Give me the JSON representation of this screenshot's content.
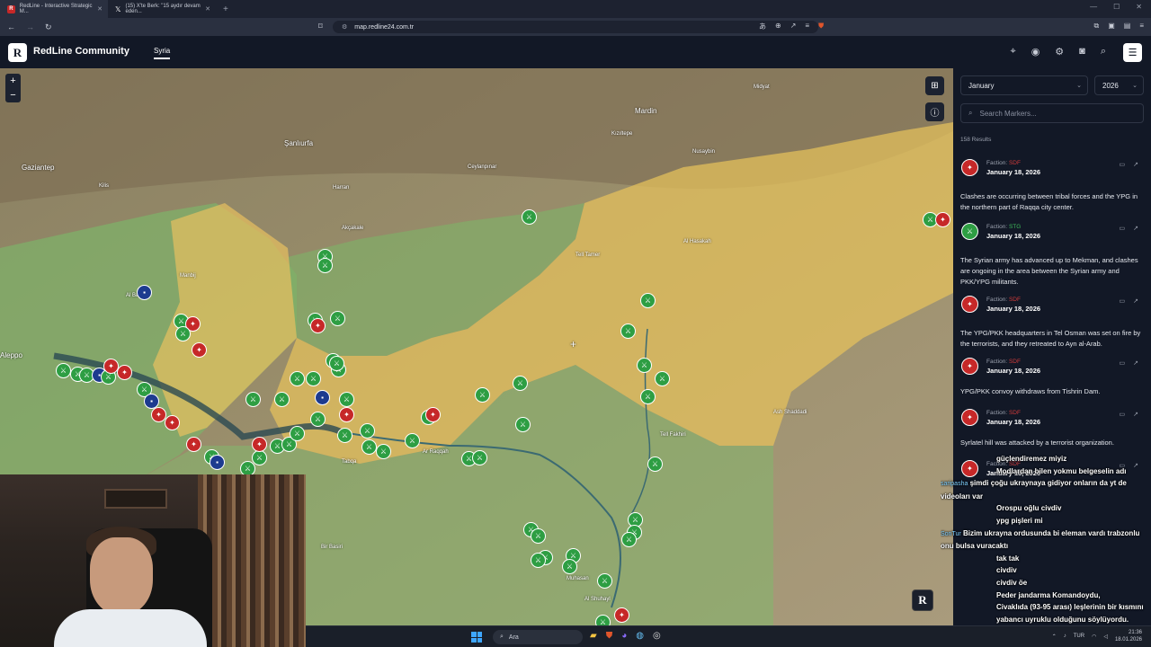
{
  "browser": {
    "tabs": [
      {
        "label": "RedLine - Interactive Strategic M..."
      },
      {
        "label": "(15) X'te Berk: \"15 aydır devam eden..."
      }
    ],
    "url": "map.redline24.com.tr"
  },
  "header": {
    "brand": "RedLine Community",
    "logo_letter": "R",
    "region_tab": "Syria"
  },
  "map": {
    "zoom_in": "+",
    "zoom_out": "−",
    "labels": [
      {
        "text": "Gaziantep",
        "big": true
      },
      {
        "text": "Şanlıurfa",
        "big": true
      },
      {
        "text": "Mardin",
        "big": true
      },
      {
        "text": "Aleppo",
        "big": true
      },
      {
        "text": "Kilis"
      },
      {
        "text": "Harran"
      },
      {
        "text": "Akçakale"
      },
      {
        "text": "Ceylanpınar"
      },
      {
        "text": "Kızıltepe"
      },
      {
        "text": "Nusaybin"
      },
      {
        "text": "Midyat"
      },
      {
        "text": "Al Hasakah"
      },
      {
        "text": "Tell Tamer"
      },
      {
        "text": "Ash Shaddadi"
      },
      {
        "text": "Al Bab"
      },
      {
        "text": "Manbij"
      },
      {
        "text": "Ar Raqqah"
      },
      {
        "text": "Tabqa"
      },
      {
        "text": "Muhasan"
      },
      {
        "text": "Al Shuhayl"
      },
      {
        "text": "Bir Basiri"
      },
      {
        "text": "Tell Fakhiri"
      }
    ]
  },
  "sidebar": {
    "month": "January",
    "year": "2026",
    "search_placeholder": "Search Markers...",
    "results": "158 Results",
    "faction_label": "Faction:",
    "cards": [
      {
        "faction": "SDF",
        "date": "January 18, 2026",
        "desc": "Clashes are occurring between tribal forces and the YPG in the northern part of Raqqa city center."
      },
      {
        "faction": "STG",
        "date": "January 18, 2026",
        "desc": "The Syrian army has advanced up to Mekman, and clashes are ongoing in the area between the Syrian army and PKK/YPG militants."
      },
      {
        "faction": "SDF",
        "date": "January 18, 2026",
        "desc": "The YPG/PKK headquarters in Tel Osman was set on fire by the terrorists, and they retreated to Ayn al-Arab."
      },
      {
        "faction": "SDF",
        "date": "January 18, 2026",
        "desc": "YPG/PKK convoy withdraws from Tishrin Dam."
      },
      {
        "faction": "SDF",
        "date": "January 18, 2026",
        "desc": "Syrlatel hill was attacked by a terrorist organization."
      },
      {
        "faction": "SDF",
        "date": "January 18, 2026",
        "desc": ""
      }
    ]
  },
  "chat": [
    {
      "user": "",
      "msg": "güçlendiremez miyiz"
    },
    {
      "user": "",
      "msg": "Modlardan bilen yokmu belgeselin adı"
    },
    {
      "user": "saripasha",
      "msg": "şimdi çoğu ukraynaya gidiyor onların da yt de videoları var"
    },
    {
      "user": "",
      "msg": "Orospu oğlu civdiv"
    },
    {
      "user": "",
      "msg": "ypg pişleri mi"
    },
    {
      "user": "SonTur",
      "msg": "Bizim ukrayna ordusunda bi eleman vardı trabzonlu onu bulsa vuracaktı"
    },
    {
      "user": "",
      "msg": "tak tak"
    },
    {
      "user": "",
      "msg": "civdiv"
    },
    {
      "user": "",
      "msg": "civdiv öe"
    },
    {
      "user": "",
      "msg": "Peder jandarma Komandoydu,"
    },
    {
      "user": "",
      "msg": "Civaklıda (93-95 arası) leşlerinin bir kısmını yabancı uyruklu olduğunu söylüyordu."
    }
  ],
  "taskbar": {
    "search": "Ara",
    "lang": "TUR",
    "time": "21:36",
    "date": "18.01.2026"
  }
}
